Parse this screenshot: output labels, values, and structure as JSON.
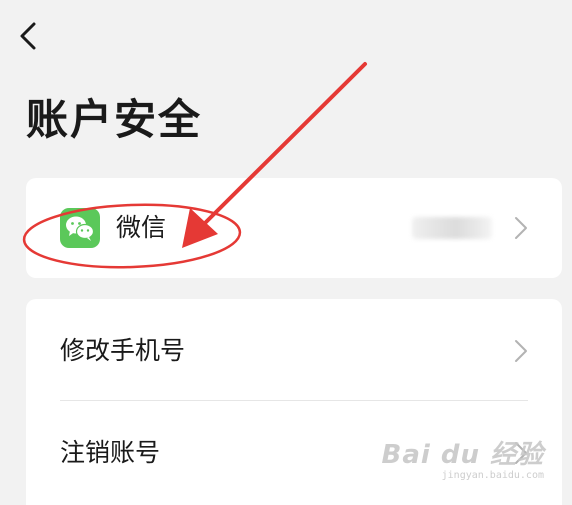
{
  "header": {
    "back_icon": "chevron-left-icon",
    "title": "账户安全"
  },
  "wechat_card": {
    "icon": "wechat-icon",
    "label": "微信",
    "value_obscured": true,
    "chevron_icon": "chevron-right-icon"
  },
  "settings_card": {
    "items": [
      {
        "label": "修改手机号",
        "chevron_icon": "chevron-right-icon"
      },
      {
        "label": "注销账号",
        "chevron_icon": "chevron-right-icon"
      }
    ]
  },
  "annotation": {
    "color": "#e53935",
    "shapes": [
      "red-ellipse",
      "red-arrow"
    ]
  },
  "watermark": {
    "brand": "Bai du 经验",
    "url": "jingyan.baidu.com"
  },
  "colors": {
    "background": "#f2f2f2",
    "card": "#ffffff",
    "wechat_green": "#5bc85a",
    "chevron": "#b3b3b3"
  }
}
